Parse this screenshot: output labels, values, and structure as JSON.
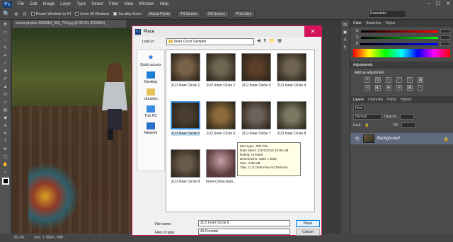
{
  "app": {
    "logo": "Ps",
    "menu": [
      "File",
      "Edit",
      "Image",
      "Layer",
      "Type",
      "Select",
      "Filter",
      "View",
      "Window",
      "Help"
    ],
    "window_controls": [
      "–",
      "☐",
      "✕"
    ]
  },
  "options_bar": {
    "resize_windows": "Resize Windows to Fit",
    "zoom_all": "Zoom All Windows",
    "scrubby_zoom": "Scrubby Zoom",
    "actual_pixels": "Actual Pixels",
    "fit_screen": "Fit Screen",
    "fill_screen": "Fill Screen",
    "print_size": "Print Size",
    "workspace": "Essentials"
  },
  "document": {
    "tab": "senior-photos-2260684_960_720.jpg @ 92.2% (RGB/8#)",
    "zoom": "92.2%",
    "doc_size": "Doc: 1.78M/1.78M"
  },
  "panels": {
    "color_tabs": [
      "Color",
      "Swatches",
      "Styles"
    ],
    "channels": [
      "R",
      "G",
      "B"
    ],
    "adjust_tabs": [
      "Adjustments"
    ],
    "add_adjustment": "Add an adjustment",
    "layers_tabs": [
      "Layers",
      "Channels",
      "Paths",
      "History"
    ],
    "kind": "Kind",
    "blend": "Normal",
    "opacity_label": "Opacity:",
    "lock_label": "Lock:",
    "fill_label": "Fill:",
    "layer_name": "Background"
  },
  "dialog": {
    "title": "Place",
    "look_in_label": "Look in:",
    "look_in_value": "Inner Circle Sampler",
    "places": [
      "Quick access",
      "Desktop",
      "Libraries",
      "This PC",
      "Network"
    ],
    "files": [
      {
        "name": "2LO Inner Circle 1",
        "color": "#7a6248"
      },
      {
        "name": "2LO Inner Circle 2",
        "color": "#6f6650"
      },
      {
        "name": "2LO Inner Circle 3",
        "color": "#5b3f28"
      },
      {
        "name": "2LO Inner Circle 4",
        "color": "#6e6350"
      },
      {
        "name": "2LO Inner Circle 5",
        "color": "#4a3e34"
      },
      {
        "name": "2LO Inner Circle 6",
        "color": "#8a6a3a"
      },
      {
        "name": "2LO Inner Circle 7",
        "color": "#6d625a"
      },
      {
        "name": "2LO Inner Circle 8",
        "color": "#7a7a62"
      },
      {
        "name": "2LO Inner Circle 9",
        "color": "#6a5a4a"
      },
      {
        "name": "Inner-Circle-Sam...",
        "color": "#8a6f6a"
      }
    ],
    "tooltip": [
      "Item type: JPG File",
      "Date taken: 12/22/2016 10:09 AM",
      "Rating: Unrated",
      "Dimensions: 4500 x 4500",
      "Size: 4.89 MB",
      "Title: 2 Lil' Owls Fine Art Textures"
    ],
    "filename_label": "File name:",
    "filename_value": "2LO Inner Circle 5",
    "filetype_label": "Files of type:",
    "filetype_value": "All Formats",
    "place_button": "Place",
    "cancel_button": "Cancel"
  }
}
